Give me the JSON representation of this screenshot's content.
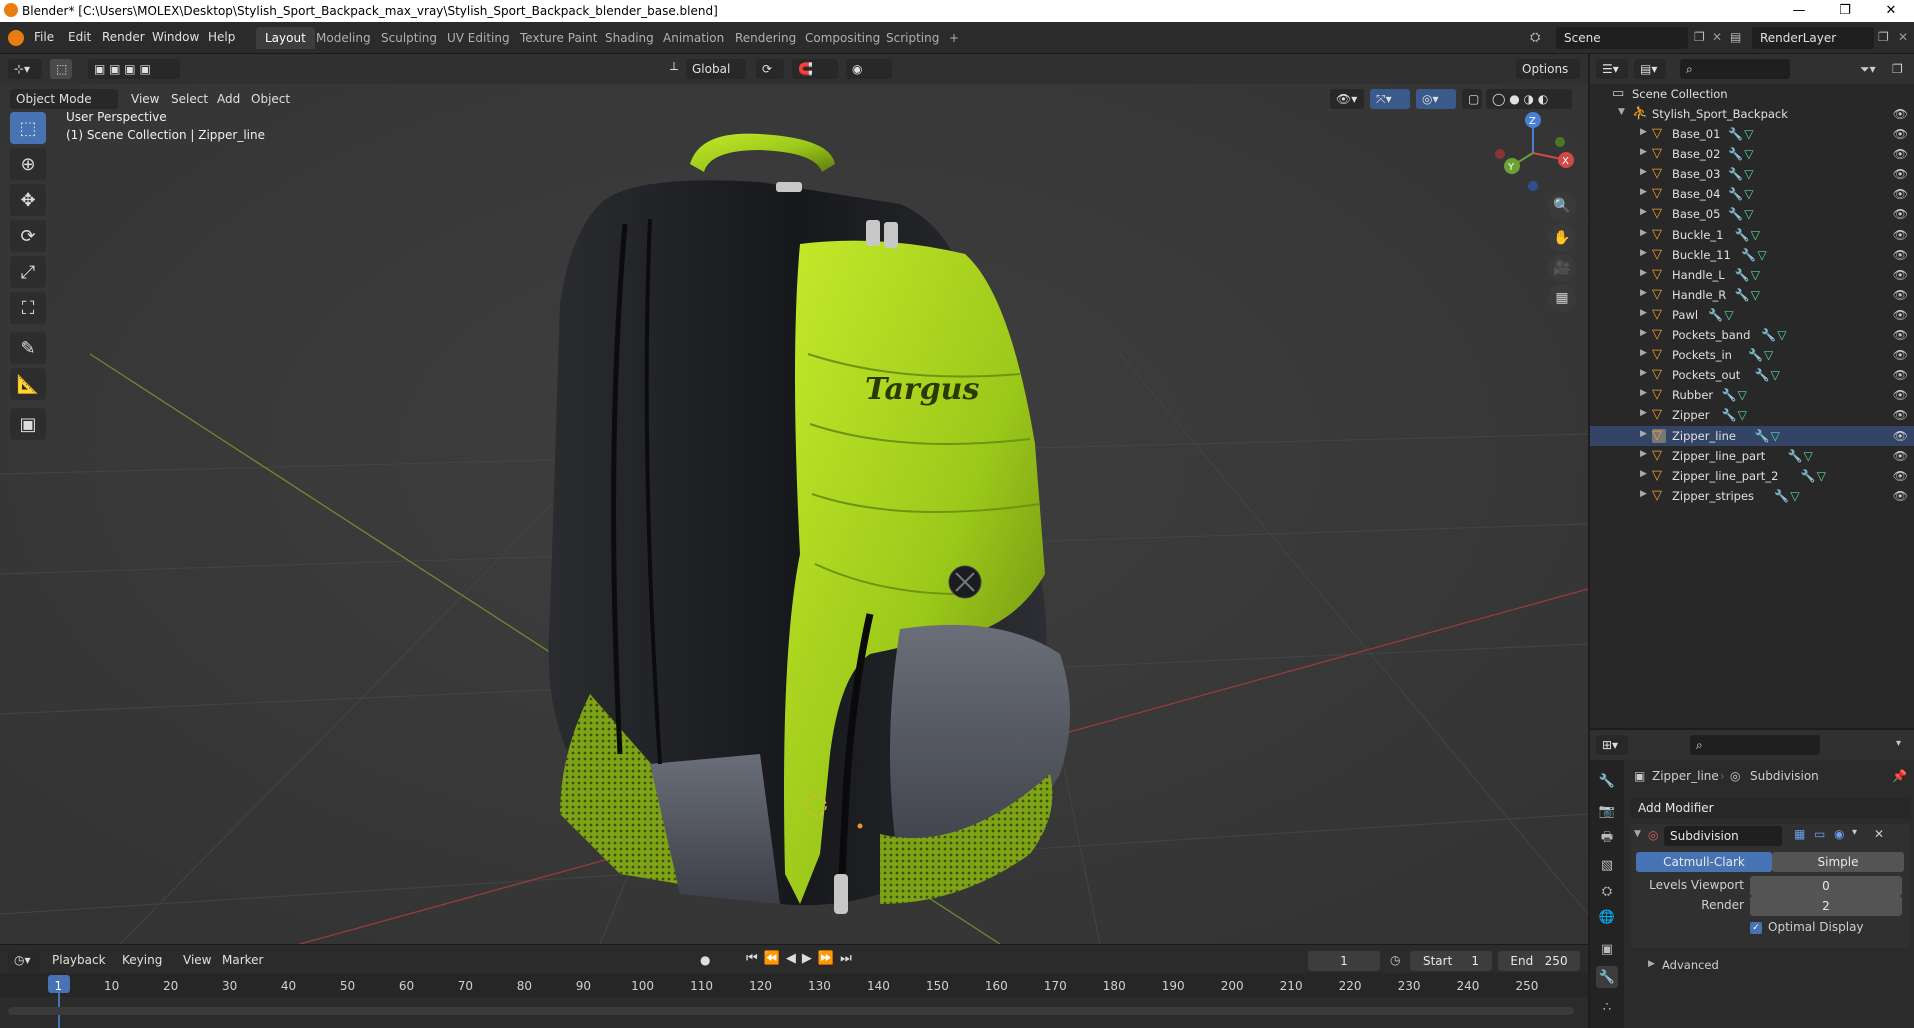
{
  "window": {
    "title": "Blender* [C:\\Users\\MOLEX\\Desktop\\Stylish_Sport_Backpack_max_vray\\Stylish_Sport_Backpack_blender_base.blend]",
    "minimize": "—",
    "maximize": "❐",
    "close": "✕"
  },
  "menu": [
    "File",
    "Edit",
    "Render",
    "Window",
    "Help"
  ],
  "workspaces": [
    "Layout",
    "Modeling",
    "Sculpting",
    "UV Editing",
    "Texture Paint",
    "Shading",
    "Animation",
    "Rendering",
    "Compositing",
    "Scripting"
  ],
  "add_workspace": "+",
  "scene": {
    "name": "Scene",
    "render_layer": "RenderLayer"
  },
  "viewport": {
    "mode": "Object Mode",
    "menus": [
      "View",
      "Select",
      "Add",
      "Object"
    ],
    "orientation": "Global",
    "options": "Options",
    "perspective": "User Perspective",
    "collection_info": "(1) Scene Collection | Zipper_line",
    "axis_labels": {
      "z": "Z",
      "y": "Y",
      "x": "X"
    },
    "logo_text": "Targus"
  },
  "outliner": {
    "root": "Scene Collection",
    "collection": "Stylish_Sport_Backpack",
    "objects": [
      "Base_01",
      "Base_02",
      "Base_03",
      "Base_04",
      "Base_05",
      "Buckle_1",
      "Buckle_11",
      "Handle_L",
      "Handle_R",
      "Pawl",
      "Pockets_band",
      "Pockets_in",
      "Pockets_out",
      "Rubber",
      "Zipper",
      "Zipper_line",
      "Zipper_line_part",
      "Zipper_line_part_2",
      "Zipper_stripes"
    ],
    "selected": "Zipper_line"
  },
  "properties": {
    "object": "Zipper_line",
    "modifier_breadcrumb": "Subdivision",
    "add_modifier": "Add Modifier",
    "modifier_name": "Subdivision",
    "catmull": "Catmull-Clark",
    "simple": "Simple",
    "levels_viewport_label": "Levels Viewport",
    "levels_viewport": "0",
    "render_label": "Render",
    "render": "2",
    "optimal_display": "Optimal Display",
    "advanced": "Advanced"
  },
  "timeline": {
    "menus": [
      "Playback",
      "Keying",
      "View",
      "Marker"
    ],
    "current_frame": "1",
    "start_label": "Start",
    "start": "1",
    "end_label": "End",
    "end": "250",
    "ticks": [
      "1",
      "10",
      "20",
      "30",
      "40",
      "50",
      "60",
      "70",
      "80",
      "90",
      "100",
      "110",
      "120",
      "130",
      "140",
      "150",
      "160",
      "170",
      "180",
      "190",
      "200",
      "210",
      "220",
      "230",
      "240",
      "250"
    ]
  },
  "colors": {
    "accent": "#4772b3",
    "viewport_bg": "#393939",
    "backpack_green": "#a6d21c",
    "backpack_black": "#1e1f22"
  }
}
